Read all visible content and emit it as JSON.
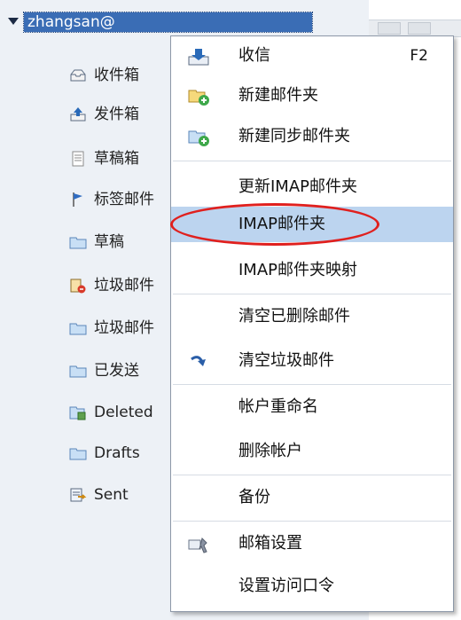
{
  "account": {
    "name": "zhangsan@"
  },
  "folders": [
    {
      "label": "收件箱",
      "icon": "inbox-icon"
    },
    {
      "label": "发件箱",
      "icon": "outbox-icon"
    },
    {
      "label": "草稿箱",
      "icon": "draft-box-icon"
    },
    {
      "label": "标签邮件",
      "icon": "flag-icon"
    },
    {
      "label": "草稿",
      "icon": "folder-icon"
    },
    {
      "label": "垃圾邮件",
      "icon": "junk-icon"
    },
    {
      "label": "垃圾邮件",
      "icon": "folder-icon"
    },
    {
      "label": "已发送",
      "icon": "folder-icon"
    },
    {
      "label": "Deleted",
      "icon": "trash-folder-icon"
    },
    {
      "label": "Drafts",
      "icon": "folder-icon"
    },
    {
      "label": "Sent",
      "icon": "sent-folder-icon"
    }
  ],
  "context_menu": {
    "items": [
      {
        "label": "收信",
        "shortcut": "F2",
        "icon": "receive-mail-icon"
      },
      {
        "label": "新建邮件夹",
        "icon": "new-folder-icon"
      },
      {
        "label": "新建同步邮件夹",
        "icon": "new-sync-folder-icon"
      },
      {
        "label": "更新IMAP邮件夹"
      },
      {
        "label": "IMAP邮件夹",
        "selected": true
      },
      {
        "label": "IMAP邮件夹映射"
      },
      {
        "label": "清空已删除邮件"
      },
      {
        "label": "清空垃圾邮件",
        "icon": "curved-arrow-icon"
      },
      {
        "label": "帐户重命名"
      },
      {
        "label": "删除帐户"
      },
      {
        "label": "备份"
      },
      {
        "label": "邮箱设置",
        "icon": "mailbox-settings-icon"
      },
      {
        "label": "设置访问口令"
      }
    ]
  },
  "colors": {
    "selection": "#3a6db5",
    "menu_highlight": "#bcd4ef",
    "annotation_oval": "#e0201e"
  }
}
